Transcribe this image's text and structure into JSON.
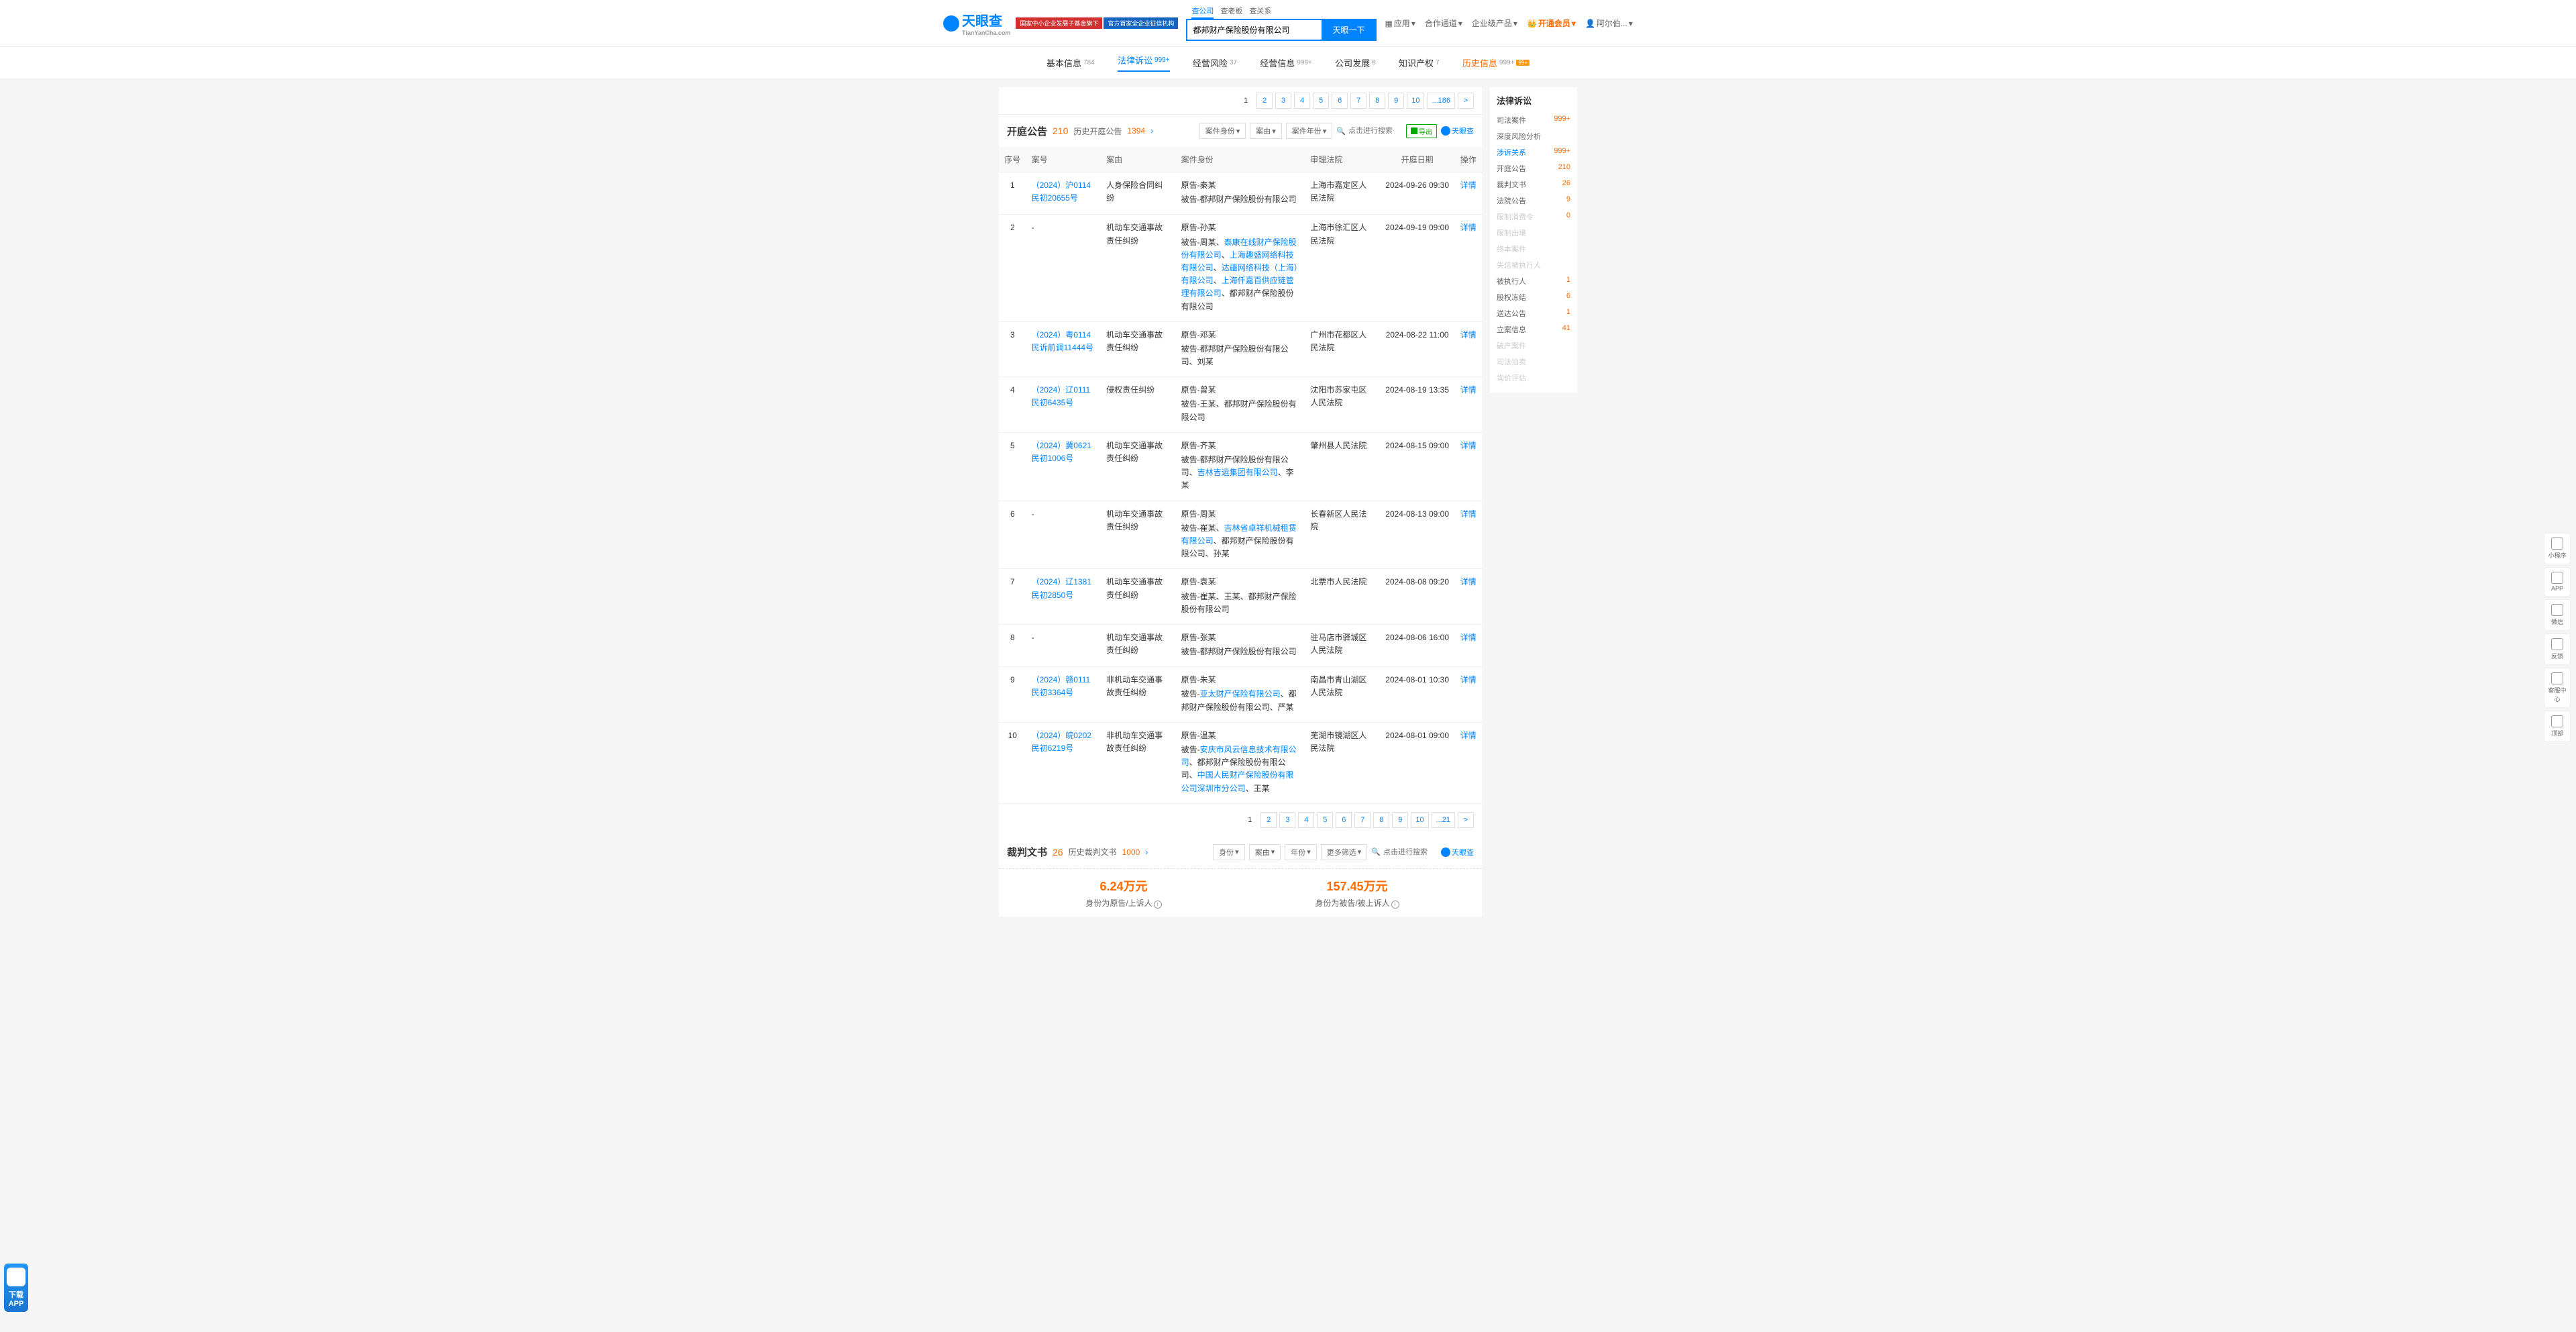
{
  "header": {
    "logo": "天眼查",
    "logo_sub": "TianYanCha.com",
    "badge1": "国家中小企业发展子基金旗下",
    "badge2": "官方首家全企业征信机构",
    "search_tabs": [
      "查公司",
      "查老板",
      "查关系"
    ],
    "search_value": "都邦财产保险股份有限公司",
    "search_btn": "天眼一下",
    "nav": [
      "应用",
      "合作通道",
      "企业级产品",
      "阿尔伯..."
    ],
    "vip": "开通会员"
  },
  "tabs": [
    {
      "label": "基本信息",
      "count": "784"
    },
    {
      "label": "法律诉讼",
      "count": "999+",
      "active": true
    },
    {
      "label": "经营风险",
      "count": "37"
    },
    {
      "label": "经营信息",
      "count": "999+"
    },
    {
      "label": "公司发展",
      "count": "8"
    },
    {
      "label": "知识产权",
      "count": "7"
    },
    {
      "label": "历史信息",
      "count": "999+",
      "history": true,
      "badge": "99+"
    }
  ],
  "pager_top": [
    "1",
    "2",
    "3",
    "4",
    "5",
    "6",
    "7",
    "8",
    "9",
    "10",
    "...186",
    ">"
  ],
  "section1": {
    "title": "开庭公告",
    "count": "210",
    "history": "历史开庭公告",
    "history_count": "1394",
    "filters": [
      "案件身份",
      "案由",
      "案件年份"
    ],
    "search_placeholder": "点击进行搜索",
    "export": "导出",
    "brand": "天眼查"
  },
  "table_headers": [
    "序号",
    "案号",
    "案由",
    "案件身份",
    "审理法院",
    "开庭日期",
    "操作"
  ],
  "rows": [
    {
      "idx": "1",
      "case": "（2024）沪0114民初20655号",
      "reason": "人身保险合同纠纷",
      "identity": [
        {
          "role": "原告",
          "text": "秦某"
        },
        {
          "role": "被告",
          "text": "都邦财产保险股份有限公司"
        }
      ],
      "court": "上海市嘉定区人民法院",
      "date": "2024-09-26 09:30"
    },
    {
      "idx": "2",
      "case": "-",
      "reason": "机动车交通事故责任纠纷",
      "identity": [
        {
          "role": "原告",
          "text": "孙某"
        },
        {
          "role": "被告",
          "text": "周某、",
          "links": [
            "泰康在线财产保险股份有限公司",
            "上海趣盛网络科技有限公司",
            "达疆网络科技（上海）有限公司",
            "上海仟嘉百供应链管理有限公司"
          ],
          "tail": "、都邦财产保险股份有限公司"
        }
      ],
      "court": "上海市徐汇区人民法院",
      "date": "2024-09-19 09:00"
    },
    {
      "idx": "3",
      "case": "（2024）粤0114民诉前调11444号",
      "reason": "机动车交通事故责任纠纷",
      "identity": [
        {
          "role": "原告",
          "text": "邓某"
        },
        {
          "role": "被告",
          "text": "都邦财产保险股份有限公司、刘某"
        }
      ],
      "court": "广州市花都区人民法院",
      "date": "2024-08-22 11:00"
    },
    {
      "idx": "4",
      "case": "（2024）辽0111民初6435号",
      "reason": "侵权责任纠纷",
      "identity": [
        {
          "role": "原告",
          "text": "曾某"
        },
        {
          "role": "被告",
          "text": "王某、都邦财产保险股份有限公司"
        }
      ],
      "court": "沈阳市苏家屯区人民法院",
      "date": "2024-08-19 13:35"
    },
    {
      "idx": "5",
      "case": "（2024）冀0621民初1006号",
      "reason": "机动车交通事故责任纠纷",
      "identity": [
        {
          "role": "原告",
          "text": "齐某"
        },
        {
          "role": "被告",
          "text": "都邦财产保险股份有限公司、",
          "links": [
            "吉林吉运集团有限公司"
          ],
          "tail": "、李某"
        }
      ],
      "court": "肇州县人民法院",
      "date": "2024-08-15 09:00"
    },
    {
      "idx": "6",
      "case": "-",
      "reason": "机动车交通事故责任纠纷",
      "identity": [
        {
          "role": "原告",
          "text": "周某"
        },
        {
          "role": "被告",
          "text": "崔某、",
          "links": [
            "吉林省卓祥机械租赁有限公司"
          ],
          "tail": "、都邦财产保险股份有限公司、孙某"
        }
      ],
      "court": "长春新区人民法院",
      "date": "2024-08-13 09:00"
    },
    {
      "idx": "7",
      "case": "（2024）辽1381民初2850号",
      "reason": "机动车交通事故责任纠纷",
      "identity": [
        {
          "role": "原告",
          "text": "袁某"
        },
        {
          "role": "被告",
          "text": "崔某、王某、都邦财产保险股份有限公司"
        }
      ],
      "court": "北票市人民法院",
      "date": "2024-08-08 09:20"
    },
    {
      "idx": "8",
      "case": "-",
      "reason": "机动车交通事故责任纠纷",
      "identity": [
        {
          "role": "原告",
          "text": "张某"
        },
        {
          "role": "被告",
          "text": "都邦财产保险股份有限公司"
        }
      ],
      "court": "驻马店市驿城区人民法院",
      "date": "2024-08-06 16:00"
    },
    {
      "idx": "9",
      "case": "（2024）赣0111民初3364号",
      "reason": "非机动车交通事故责任纠纷",
      "identity": [
        {
          "role": "原告",
          "text": "朱某"
        },
        {
          "role": "被告",
          "links": [
            "亚太财产保险有限公司"
          ],
          "tail": "、都邦财产保险股份有限公司、严某"
        }
      ],
      "court": "南昌市青山湖区人民法院",
      "date": "2024-08-01 10:30"
    },
    {
      "idx": "10",
      "case": "（2024）皖0202民初6219号",
      "reason": "非机动车交通事故责任纠纷",
      "identity": [
        {
          "role": "原告",
          "text": "温某"
        },
        {
          "role": "被告",
          "links": [
            "安庆市风云信息技术有限公司"
          ],
          "tail": "、都邦财产保险股份有限公司、",
          "links2": [
            "中国人民财产保险股份有限公司深圳市分公司"
          ],
          "tail2": "、王某"
        }
      ],
      "court": "芜湖市镜湖区人民法院",
      "date": "2024-08-01 09:00"
    }
  ],
  "detail_label": "详情",
  "pager_bottom": [
    "1",
    "2",
    "3",
    "4",
    "5",
    "6",
    "7",
    "8",
    "9",
    "10",
    "...21",
    ">"
  ],
  "section2": {
    "title": "裁判文书",
    "count": "26",
    "history": "历史裁判文书",
    "history_count": "1000",
    "filters": [
      "身份",
      "案由",
      "年份",
      "更多筛选"
    ],
    "search_placeholder": "点击进行搜索",
    "brand": "天眼查"
  },
  "summary": {
    "left_val": "6.24万元",
    "left_label": "身份为原告/上诉人",
    "right_val": "157.45万元",
    "right_label": "身份为被告/被上诉人"
  },
  "sidebar": {
    "title": "法律诉讼",
    "items": [
      {
        "label": "司法案件",
        "count": "999+"
      },
      {
        "label": "深度风险分析"
      },
      {
        "label": "涉诉关系",
        "count": "999+",
        "active": true
      },
      {
        "label": "开庭公告",
        "count": "210"
      },
      {
        "label": "裁判文书",
        "count": "26"
      },
      {
        "label": "法院公告",
        "count": "9"
      },
      {
        "label": "限制消费令",
        "count": "0",
        "disabled": true
      },
      {
        "label": "限制出境",
        "disabled": true
      },
      {
        "label": "终本案件",
        "disabled": true
      },
      {
        "label": "失信被执行人",
        "disabled": true
      },
      {
        "label": "被执行人",
        "count": "1"
      },
      {
        "label": "股权冻结",
        "count": "6"
      },
      {
        "label": "送达公告",
        "count": "1"
      },
      {
        "label": "立案信息",
        "count": "41"
      },
      {
        "label": "破产案件",
        "disabled": true
      },
      {
        "label": "司法拍卖",
        "disabled": true
      },
      {
        "label": "询价评估",
        "disabled": true
      }
    ]
  },
  "float_right": [
    "小程序",
    "APP",
    "微信",
    "反馈",
    "客服中心",
    "顶部"
  ],
  "float_left": {
    "download": "下载",
    "app": "APP"
  }
}
